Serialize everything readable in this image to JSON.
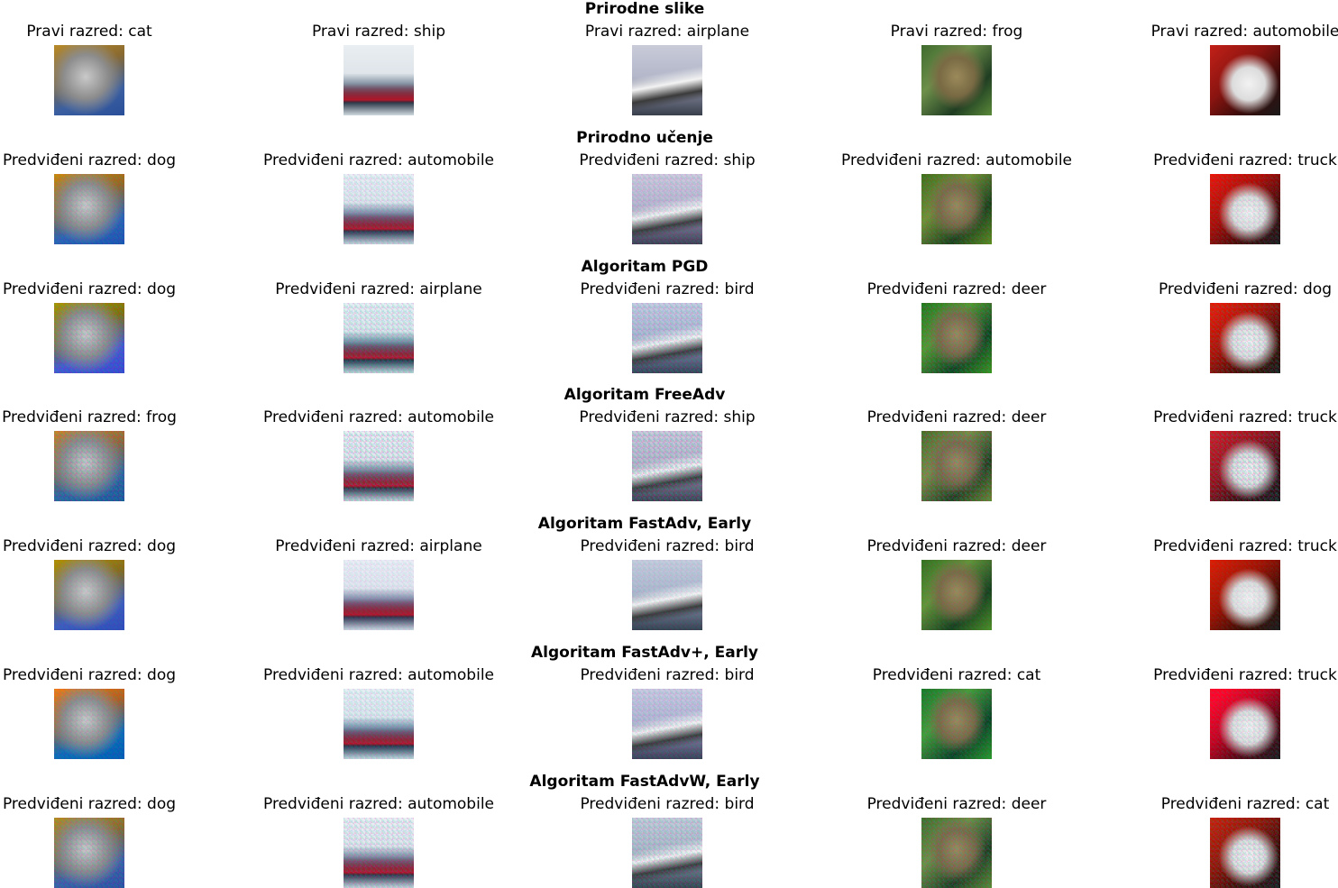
{
  "rows": [
    {
      "title": "Prirodne slike",
      "labels": [
        "Pravi razred: cat",
        "Pravi razred: ship",
        "Pravi razred: airplane",
        "Pravi razred: frog",
        "Pravi razred: automobile"
      ]
    },
    {
      "title": "Prirodno učenje",
      "labels": [
        "Predviđeni razred: dog",
        "Predviđeni razred: automobile",
        "Predviđeni razred: ship",
        "Predviđeni razred: automobile",
        "Predviđeni razred: truck"
      ]
    },
    {
      "title": "Algoritam PGD",
      "labels": [
        "Predviđeni razred: dog",
        "Predviđeni razred: airplane",
        "Predviđeni razred: bird",
        "Predviđeni razred: deer",
        "Predviđeni razred: dog"
      ]
    },
    {
      "title": "Algoritam FreeAdv",
      "labels": [
        "Predviđeni razred: frog",
        "Predviđeni razred: automobile",
        "Predviđeni razred: ship",
        "Predviđeni razred: deer",
        "Predviđeni razred: truck"
      ]
    },
    {
      "title": "Algoritam FastAdv, Early",
      "labels": [
        "Predviđeni razred: dog",
        "Predviđeni razred: airplane",
        "Predviđeni razred: bird",
        "Predviđeni razred: deer",
        "Predviđeni razred: truck"
      ]
    },
    {
      "title": "Algoritam FastAdv+, Early",
      "labels": [
        "Predviđeni razred: dog",
        "Predviđeni razred: automobile",
        "Predviđeni razred: bird",
        "Predviđeni razred: cat",
        "Predviđeni razred: truck"
      ]
    },
    {
      "title": "Algoritam FastAdvW, Early",
      "labels": [
        "Predviđeni razred: dog",
        "Predviđeni razred: automobile",
        "Predviđeni razred: bird",
        "Predviđeni razred: deer",
        "Predviđeni razred: cat"
      ]
    }
  ]
}
